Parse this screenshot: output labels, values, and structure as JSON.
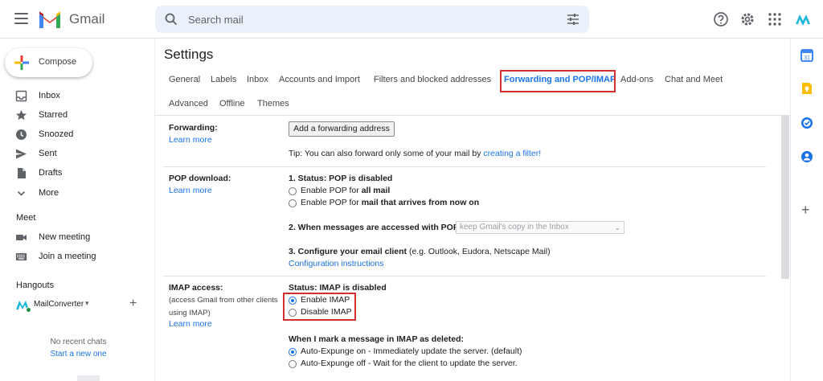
{
  "header": {
    "app_name": "Gmail",
    "search_placeholder": "Search mail",
    "icons": [
      "menu-icon",
      "gmail-logo",
      "search-icon",
      "tune-icon",
      "help-icon",
      "settings-icon",
      "apps-icon",
      "account-brand-icon"
    ]
  },
  "sidebar": {
    "compose_label": "Compose",
    "mail_items": [
      {
        "label": "Inbox",
        "icon": "inbox-icon"
      },
      {
        "label": "Starred",
        "icon": "star-icon"
      },
      {
        "label": "Snoozed",
        "icon": "clock-icon"
      },
      {
        "label": "Sent",
        "icon": "send-icon"
      },
      {
        "label": "Drafts",
        "icon": "draft-icon"
      },
      {
        "label": "More",
        "icon": "chevron-down-icon"
      }
    ],
    "meet": {
      "title": "Meet",
      "items": [
        {
          "label": "New meeting",
          "icon": "videocam-icon"
        },
        {
          "label": "Join a meeting",
          "icon": "keyboard-icon"
        }
      ]
    },
    "hangouts": {
      "title": "Hangouts",
      "user": "MailConverter",
      "caret": "▾",
      "add": "+",
      "no_chats": "No recent chats",
      "start_chat": "Start a new one"
    }
  },
  "settings": {
    "title": "Settings",
    "tabs": [
      "General",
      "Labels",
      "Inbox",
      "Accounts and Import",
      "Filters and blocked addresses",
      "Forwarding and POP/IMAP",
      "Add-ons",
      "Chat and Meet",
      "Advanced",
      "Offline",
      "Themes"
    ],
    "active_tab": "Forwarding and POP/IMAP",
    "forwarding": {
      "label": "Forwarding:",
      "learn_more": "Learn more",
      "button": "Add a forwarding address",
      "tip_prefix": "Tip: You can also forward only some of your mail by ",
      "tip_link": "creating a filter!"
    },
    "pop": {
      "label": "POP download:",
      "learn_more": "Learn more",
      "status": "1. Status: POP is disabled",
      "option1_prefix": "Enable POP for ",
      "option1_bold": "all mail",
      "option2_prefix": "Enable POP for ",
      "option2_bold": "mail that arrives from now on",
      "when_accessed": "2. When messages are accessed with POP",
      "select_value": "keep Gmail's copy in the Inbox",
      "configure_bold": "3. Configure your email client",
      "configure_rest": " (e.g. Outlook, Eudora, Netscape Mail)",
      "config_link": "Configuration instructions"
    },
    "imap": {
      "label": "IMAP access:",
      "sub": "(access Gmail from other clients using IMAP)",
      "learn_more": "Learn more",
      "status": "Status: IMAP is disabled",
      "enable": "Enable IMAP",
      "disable": "Disable IMAP",
      "selected": "Enable IMAP",
      "deleted_title": "When I mark a message in IMAP as deleted:",
      "expunge_on": "Auto-Expunge on - Immediately update the server. (default)",
      "expunge_off": "Auto-Expunge off - Wait for the client to update the server.",
      "expunge_selected": "Auto-Expunge on - Immediately update the server. (default)"
    }
  },
  "side_panel": {
    "icons": [
      "calendar-icon",
      "keep-icon",
      "tasks-icon",
      "contacts-icon"
    ],
    "add": "+"
  },
  "colors": {
    "accent": "#1a73e8",
    "highlight": "#d32f2f",
    "search_bg": "#eaf1fb"
  }
}
